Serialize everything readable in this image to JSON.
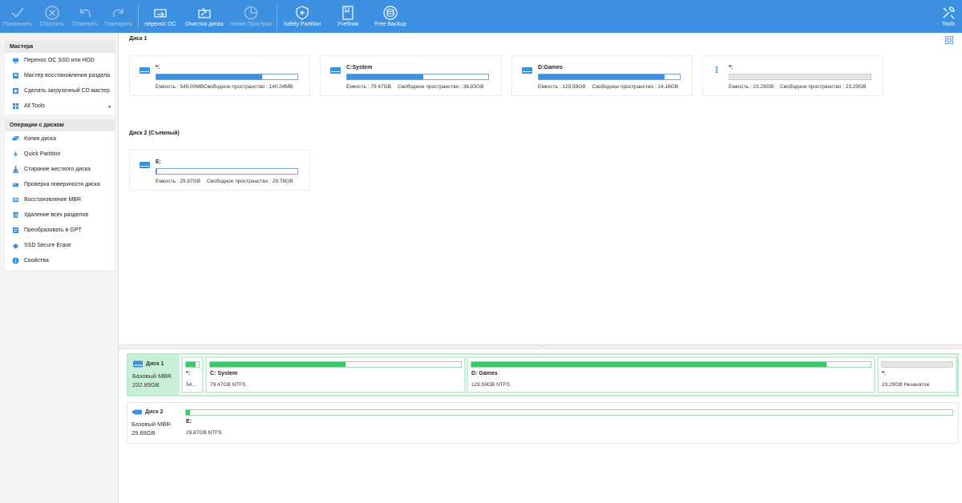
{
  "toolbar": {
    "buttons": [
      {
        "label": "Применить",
        "icon": "check-icon",
        "disabled": true
      },
      {
        "label": "Сбросить",
        "icon": "cancel-icon",
        "disabled": true
      },
      {
        "label": "Отменить",
        "icon": "undo-icon",
        "disabled": true
      },
      {
        "label": "Повторить",
        "icon": "redo-icon",
        "disabled": true
      },
      {
        "label": "перенос ОС",
        "icon": "migrate-os-icon",
        "disabled": false
      },
      {
        "label": "Очистка диска",
        "icon": "disk-cleanup-icon",
        "disabled": false
      },
      {
        "label": "ление Простран",
        "icon": "space-analyzer-icon",
        "disabled": true
      },
      {
        "label": "Safely Partition",
        "icon": "shield-icon",
        "disabled": false
      },
      {
        "label": "Учебник",
        "icon": "tutorial-icon",
        "disabled": false
      },
      {
        "label": "Free Backup",
        "icon": "backup-icon",
        "disabled": false
      },
      {
        "label": "Tools",
        "icon": "tools-icon",
        "disabled": false
      }
    ]
  },
  "left": {
    "wizards_title": "Мастера",
    "wizards": [
      {
        "label": "Перенос ОС SSD или HDD",
        "icon": "migrate-icon"
      },
      {
        "label": "Мастер восстановления раздела",
        "icon": "recovery-icon"
      },
      {
        "label": "Сделать загрузочный CD мастер",
        "icon": "bootable-cd-icon"
      },
      {
        "label": "All Tools",
        "icon": "all-tools-icon",
        "arrow": "▸"
      }
    ],
    "ops_title": "Операции с диском",
    "ops": [
      {
        "label": "Копия диска",
        "icon": "disk-copy-icon"
      },
      {
        "label": "Quick Partition",
        "icon": "lightning-icon"
      },
      {
        "label": "Стирание жесткого диска",
        "icon": "wipe-icon"
      },
      {
        "label": "Проверка поверхности диска",
        "icon": "surface-test-icon"
      },
      {
        "label": "Восстановление MBR",
        "icon": "mbr-icon"
      },
      {
        "label": "Удаление всех разделов",
        "icon": "delete-icon"
      },
      {
        "label": "Преобразовать в GPT",
        "icon": "convert-icon"
      },
      {
        "label": "SSD Secure Erase",
        "icon": "ssd-erase-icon"
      },
      {
        "label": "Свойства",
        "icon": "info-icon"
      }
    ]
  },
  "main": {
    "disk1_label": "Диск 1",
    "disk2_label": "Диск 2 (Съемный)",
    "cards": [
      {
        "name": "*:",
        "fill": 0.75,
        "cap": "Емкость : 549.00MB",
        "free": "Свободное пространство : 140.04MB",
        "empty": false
      },
      {
        "name": "C:System",
        "fill": 0.54,
        "cap": "Емкость : 79.47GB",
        "free": "Свободное пространство : 36.83GB",
        "empty": false
      },
      {
        "name": "D:Games",
        "fill": 0.89,
        "cap": "Емкость : 129.59GB",
        "free": "Свободное пространство : 14.16GB",
        "empty": false
      },
      {
        "name": "*:",
        "fill": 0,
        "cap": "Емкость : 23.29GB",
        "free": "Свободное пространство : 23.29GB",
        "empty": true
      },
      {
        "name": "E:",
        "fill": 0.005,
        "cap": "Емкость : 29.87GB",
        "free": "Свободное пространство : 29.78GB",
        "empty": false
      }
    ]
  },
  "map": {
    "disk1": {
      "title": "Диск 1",
      "type": "Базовый MBR",
      "size": "232.89GB"
    },
    "disk2": {
      "title": "Диск 2",
      "type": "Базовый MBR",
      "size": "29.88GB"
    },
    "parts1": [
      {
        "name": "*:",
        "info": "54...",
        "fill": 0.75,
        "unalloc": false
      },
      {
        "name": "C: System",
        "info": "79.47GB NTFS",
        "fill": 0.54,
        "unalloc": false
      },
      {
        "name": "D: Games",
        "info": "129.59GB NTFS",
        "fill": 0.89,
        "unalloc": false
      },
      {
        "name": "*:",
        "info": "23.29GB Незанятое",
        "fill": 0,
        "unalloc": true
      }
    ],
    "parts2": [
      {
        "name": "E:",
        "info": "29.87GB NTFS",
        "fill": 0.005,
        "unalloc": false
      }
    ]
  }
}
